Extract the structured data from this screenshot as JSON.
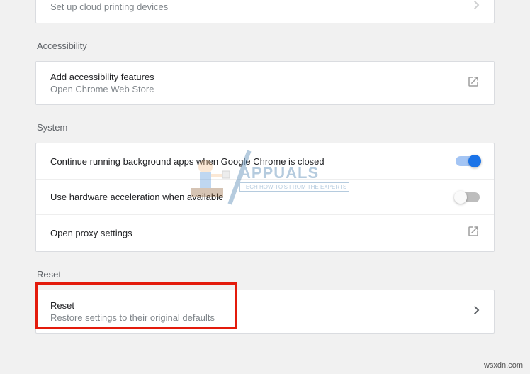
{
  "cloudPrint": {
    "subtitle": "Set up cloud printing devices"
  },
  "accessibility": {
    "header": "Accessibility",
    "addFeatures": {
      "title": "Add accessibility features",
      "subtitle": "Open Chrome Web Store"
    }
  },
  "system": {
    "header": "System",
    "backgroundApps": {
      "title": "Continue running background apps when Google Chrome is closed",
      "toggled": true
    },
    "hardwareAccel": {
      "title": "Use hardware acceleration when available",
      "toggled": false
    },
    "proxy": {
      "title": "Open proxy settings"
    }
  },
  "reset": {
    "header": "Reset",
    "item": {
      "title": "Reset",
      "subtitle": "Restore settings to their original defaults"
    }
  },
  "watermark": {
    "brand": "APPUALS",
    "tagline": "TECH HOW-TO'S FROM THE EXPERTS"
  },
  "source": "wsxdn.com"
}
